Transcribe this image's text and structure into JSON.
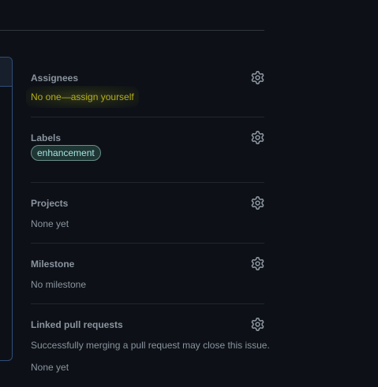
{
  "assignees": {
    "title": "Assignees",
    "value": "No one—assign yourself",
    "icon": "gear-icon"
  },
  "labels": {
    "title": "Labels",
    "items": [
      "enhancement"
    ],
    "label_color": "#a6e3e0",
    "icon": "gear-icon"
  },
  "projects": {
    "title": "Projects",
    "value": "None yet",
    "icon": "gear-icon"
  },
  "milestone": {
    "title": "Milestone",
    "value": "No milestone",
    "icon": "gear-icon"
  },
  "linked_pull_requests": {
    "title": "Linked pull requests",
    "description": "Successfully merging a pull request may close this issue.",
    "value": "None yet",
    "icon": "gear-icon"
  },
  "colors": {
    "background": "#0d1117",
    "text_muted": "#8b949e",
    "highlight": "#b4ae1e",
    "border": "#30363d"
  }
}
